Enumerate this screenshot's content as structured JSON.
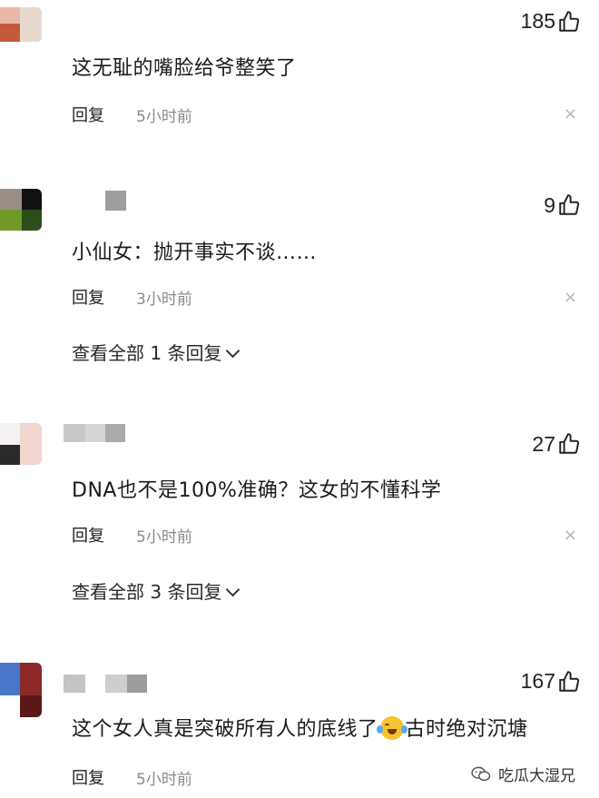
{
  "comments": [
    {
      "likes": "185",
      "text": "这无耻的嘴脸给爷整笑了",
      "reply_label": "回复",
      "time": "5小时前",
      "view_all": ""
    },
    {
      "likes": "9",
      "text": "小仙女：抛开事实不谈……",
      "reply_label": "回复",
      "time": "3小时前",
      "view_all": "查看全部 1 条回复"
    },
    {
      "likes": "27",
      "text": "DNA也不是100%准确？这女的不懂科学",
      "reply_label": "回复",
      "time": "5小时前",
      "view_all": "查看全部 3 条回复"
    },
    {
      "likes": "167",
      "text_before": "这个女人真是突破所有人的底线了",
      "emoji_icon": "crying-laughing-emoji",
      "text_after": "古时绝对沉塘",
      "reply_label": "回复",
      "time": "5小时前"
    }
  ],
  "close_glyph": "×",
  "watermark": {
    "text": "吃瓜大湿兄",
    "icon": "wechat-icon"
  },
  "like_icon": "thumbs-up-icon"
}
